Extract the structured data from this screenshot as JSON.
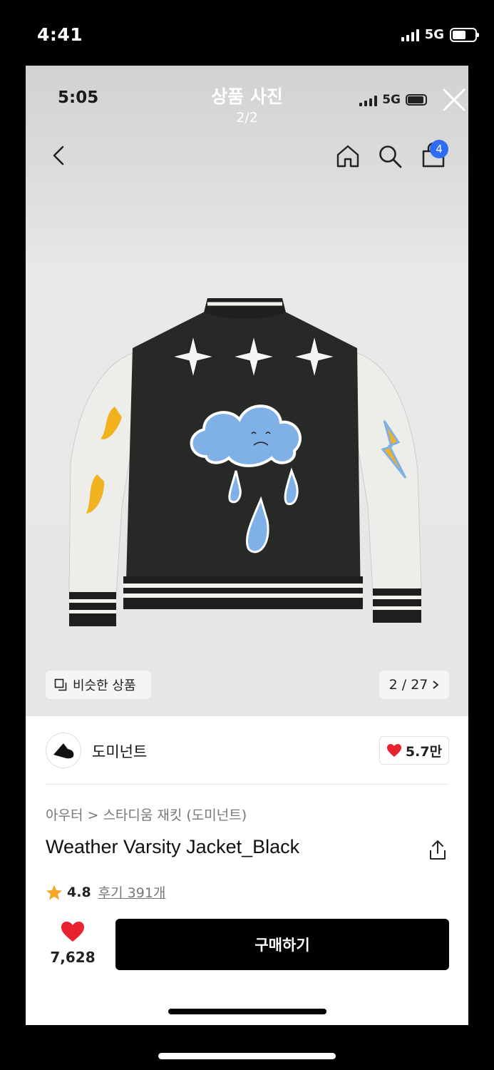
{
  "outer_status": {
    "time": "4:41",
    "network": "5G"
  },
  "inner_status": {
    "time": "5:05",
    "network": "5G"
  },
  "viewer": {
    "title": "상품 사진",
    "count": "2/2"
  },
  "header": {
    "cart_badge": "4"
  },
  "photo": {
    "similar_label": "비슷한 상품",
    "page_indicator": "2 / 27"
  },
  "brand": {
    "name": "도미넌트",
    "likes": "5.7만"
  },
  "product": {
    "breadcrumb": "아우터 > 스타디움 재킷 (도미넌트)",
    "name": "Weather Varsity Jacket_Black",
    "rating": "4.8",
    "reviews": "후기 391개"
  },
  "footer": {
    "wish_count": "7,628",
    "buy_label": "구매하기"
  },
  "colors": {
    "accent_blue": "#2f6cf6",
    "heart_red": "#e8232f",
    "star_orange": "#f5a623",
    "buy_button": "#000000"
  },
  "icons": [
    "back-icon",
    "home-icon",
    "search-icon",
    "bag-icon",
    "close-icon",
    "similar-icon",
    "chevron-right-icon",
    "heart-icon",
    "share-icon",
    "star-icon"
  ]
}
